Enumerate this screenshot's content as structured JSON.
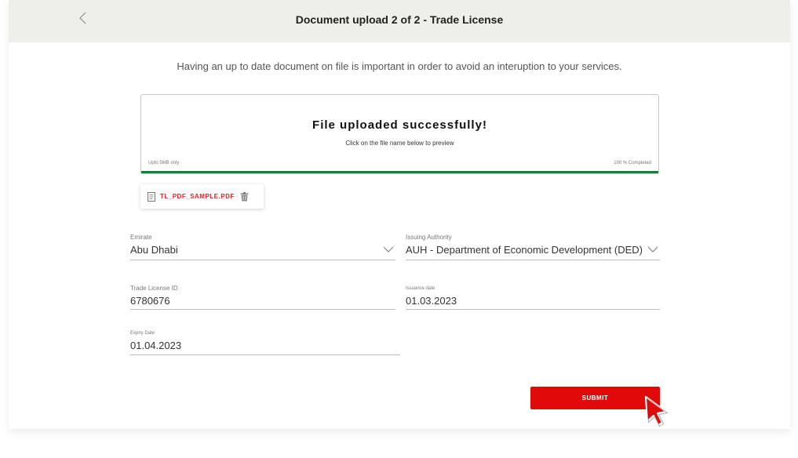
{
  "header": {
    "title": "Document upload 2 of 2 - Trade License",
    "back_icon": "chevron-left-icon"
  },
  "intro": "Having an up to date document on file is important in order to avoid an interuption to your services.",
  "upload": {
    "title": "File uploaded successfully!",
    "subtitle": "Click on the file name below to preview",
    "limit": "Upto 5MB only",
    "progress_text": "100 % Completed",
    "progress_percent": 100,
    "progress_color": "#1f7a3a"
  },
  "file": {
    "name": "TL_PDF_SAMPLE.PDF",
    "icon": "document-icon",
    "delete_icon": "trash-icon"
  },
  "form": {
    "emirate": {
      "label": "Emirate",
      "value": "Abu Dhabi"
    },
    "issuing_authority": {
      "label": "Issuing Authority",
      "value": "AUH - Department of Economic Development (DED)"
    },
    "trade_license_id": {
      "label": "Trade License ID",
      "value": "6780676"
    },
    "issuance_date": {
      "label": "Issuance date",
      "value": "01.03.2023"
    },
    "expiry_date": {
      "label": "Expiry Date",
      "value": "01.04.2023"
    }
  },
  "submit_label": "SUBMIT",
  "colors": {
    "accent": "#e00a0a",
    "header_bg": "#efefea",
    "file_name": "#d22a2a"
  }
}
